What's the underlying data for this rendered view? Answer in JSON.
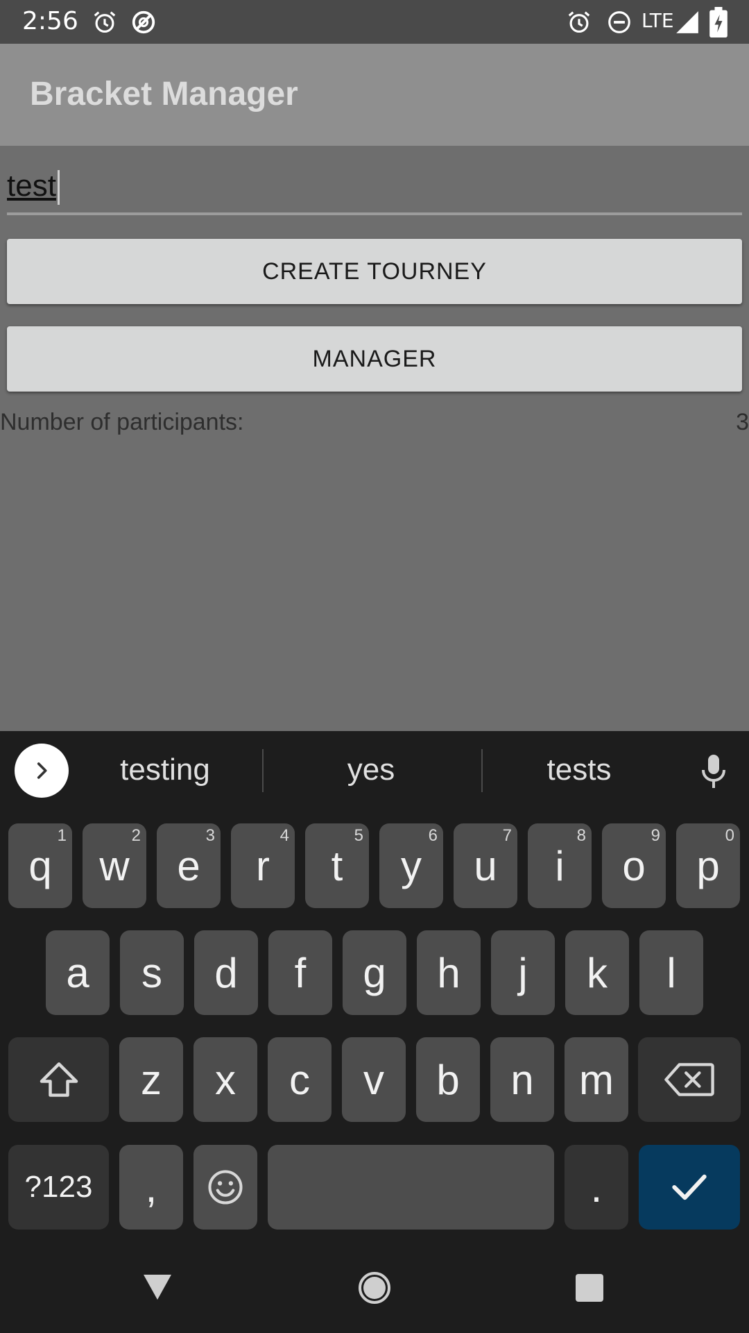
{
  "status_bar": {
    "time": "2:56",
    "network": "LTE",
    "icons": [
      "alarm-icon",
      "vpn-icon",
      "alarm-icon",
      "do-not-disturb-icon",
      "signal-icon",
      "battery-icon"
    ]
  },
  "app_bar": {
    "title": "Bracket Manager"
  },
  "form": {
    "tourney_name_value": "test",
    "create_label": "CREATE TOURNEY",
    "manager_label": "MANAGER",
    "participants_label": "Number of participants:",
    "participants_count": "3"
  },
  "keyboard": {
    "suggestions": [
      "testing",
      "yes",
      "tests"
    ],
    "row1": [
      {
        "k": "q",
        "h": "1"
      },
      {
        "k": "w",
        "h": "2"
      },
      {
        "k": "e",
        "h": "3"
      },
      {
        "k": "r",
        "h": "4"
      },
      {
        "k": "t",
        "h": "5"
      },
      {
        "k": "y",
        "h": "6"
      },
      {
        "k": "u",
        "h": "7"
      },
      {
        "k": "i",
        "h": "8"
      },
      {
        "k": "o",
        "h": "9"
      },
      {
        "k": "p",
        "h": "0"
      }
    ],
    "row2": [
      "a",
      "s",
      "d",
      "f",
      "g",
      "h",
      "j",
      "k",
      "l"
    ],
    "row3": [
      "z",
      "x",
      "c",
      "v",
      "b",
      "n",
      "m"
    ],
    "symbols_label": "?123",
    "comma": ",",
    "period": "."
  },
  "colors": {
    "app_bar": "#8f8f8f",
    "background": "#6e6e6e",
    "button": "#d6d7d7",
    "keyboard_bg": "#1d1d1d",
    "key": "#4d4d4d",
    "done_key": "#063a5e"
  }
}
